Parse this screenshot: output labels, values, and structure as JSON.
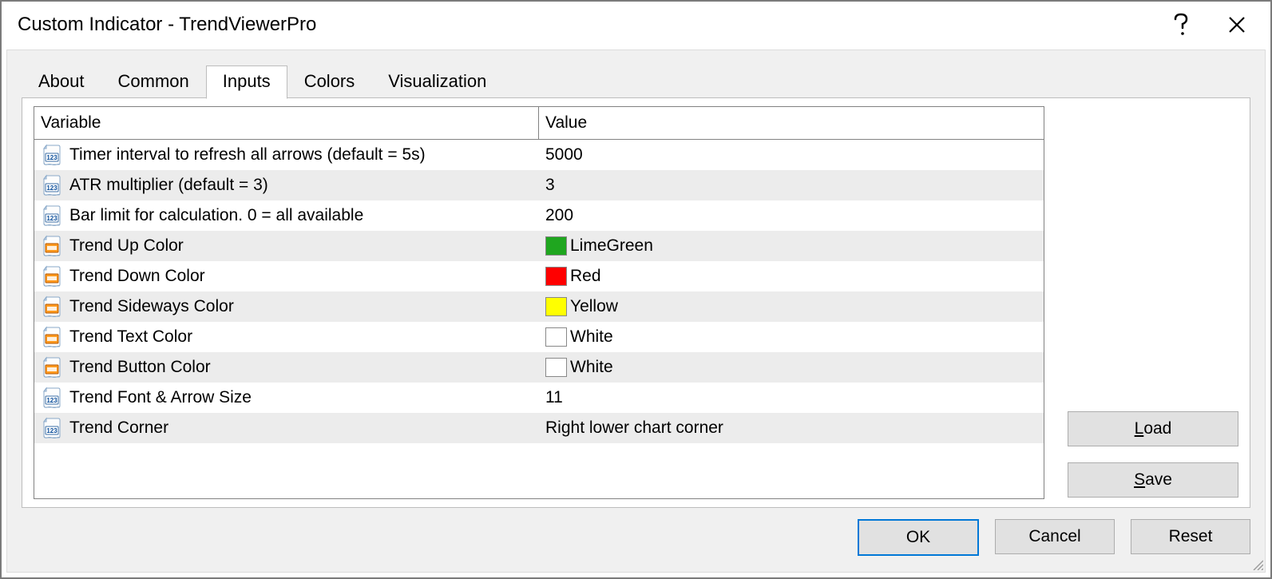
{
  "title": "Custom Indicator - TrendViewerPro",
  "tabs": [
    "About",
    "Common",
    "Inputs",
    "Colors",
    "Visualization"
  ],
  "active_tab_index": 2,
  "columns": {
    "variable": "Variable",
    "value": "Value"
  },
  "rows": [
    {
      "icon": "num",
      "variable": "Timer interval to refresh all arrows (default = 5s)",
      "value": "5000"
    },
    {
      "icon": "num",
      "variable": "ATR multiplier (default = 3)",
      "value": "3"
    },
    {
      "icon": "num",
      "variable": "Bar limit for calculation. 0 = all available",
      "value": "200"
    },
    {
      "icon": "color",
      "variable": "Trend Up Color",
      "value": "LimeGreen",
      "swatch": "#1fa61f"
    },
    {
      "icon": "color",
      "variable": "Trend Down Color",
      "value": "Red",
      "swatch": "#ff0000"
    },
    {
      "icon": "color",
      "variable": "Trend Sideways Color",
      "value": "Yellow",
      "swatch": "#ffff00"
    },
    {
      "icon": "color",
      "variable": "Trend Text Color",
      "value": "White",
      "swatch": "#ffffff"
    },
    {
      "icon": "color",
      "variable": "Trend Button Color",
      "value": "White",
      "swatch": "#ffffff"
    },
    {
      "icon": "num",
      "variable": "Trend Font & Arrow Size",
      "value": "11"
    },
    {
      "icon": "num",
      "variable": "Trend Corner",
      "value": "Right lower chart corner"
    }
  ],
  "buttons": {
    "load": "Load",
    "save": "Save",
    "ok": "OK",
    "cancel": "Cancel",
    "reset": "Reset"
  }
}
